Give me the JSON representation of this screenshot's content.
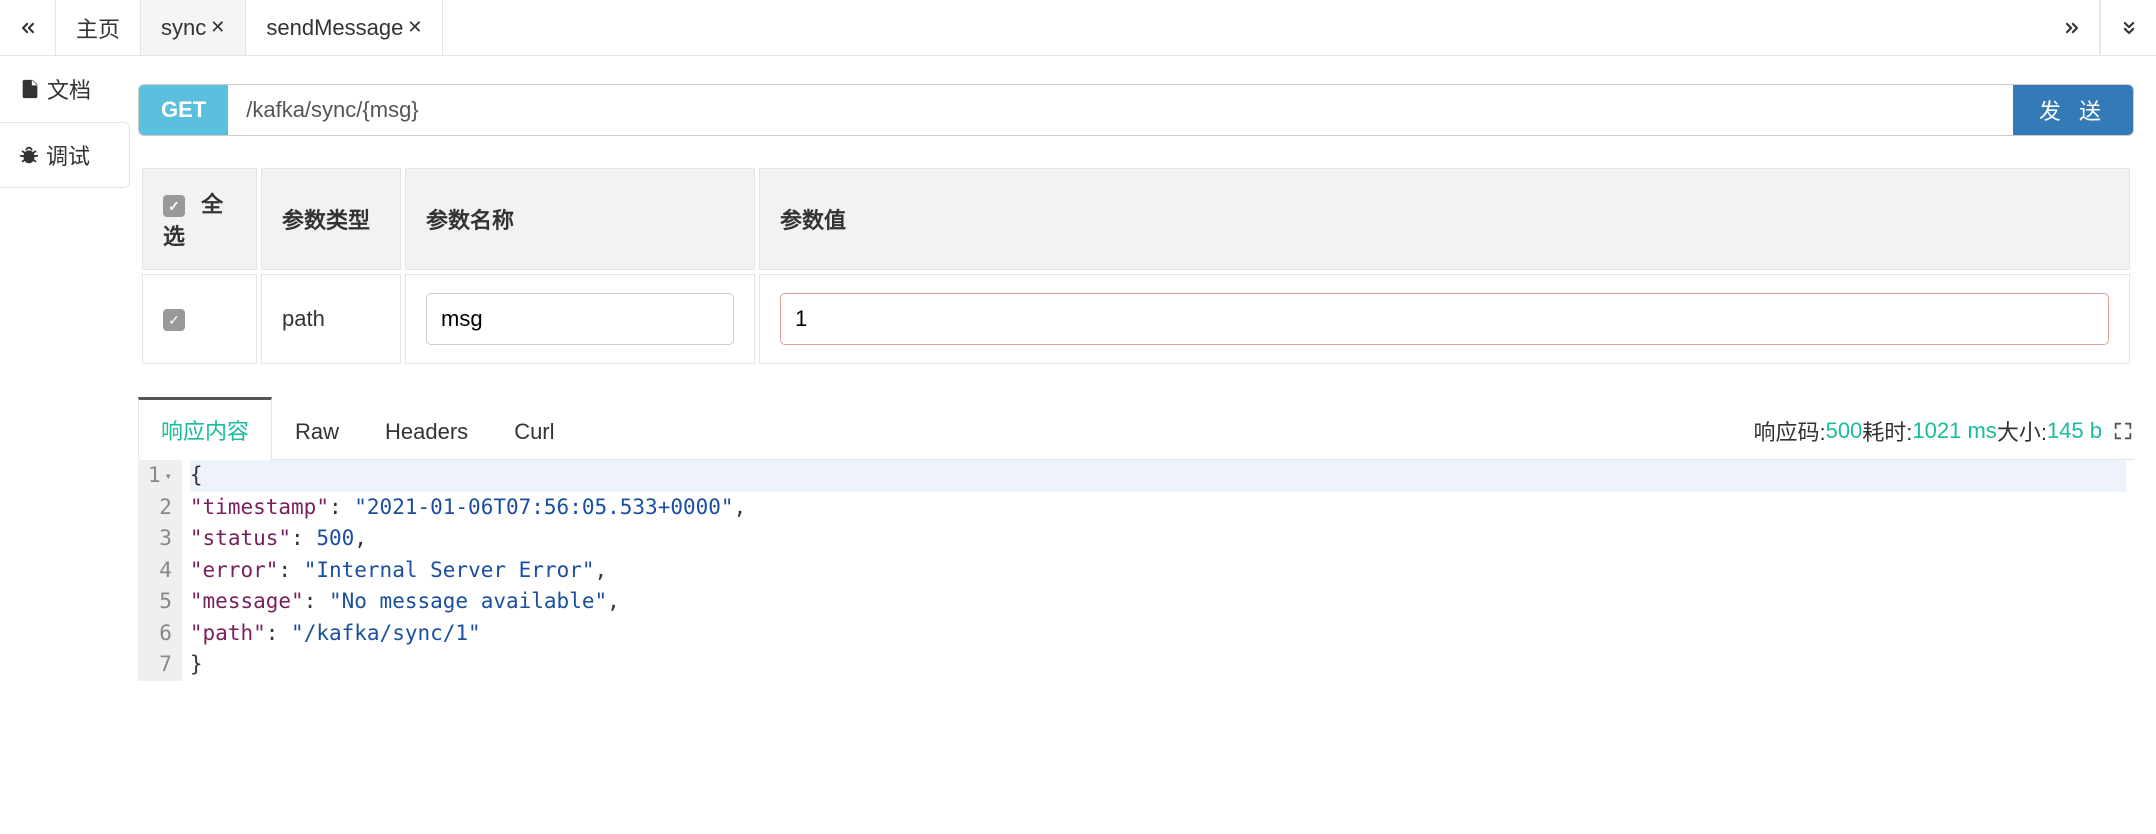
{
  "tabs": {
    "home": "主页",
    "items": [
      {
        "label": "sync",
        "active": true
      },
      {
        "label": "sendMessage",
        "active": false
      }
    ]
  },
  "sidebar": {
    "doc": "文档",
    "debug": "调试"
  },
  "request": {
    "method": "GET",
    "url": "/kafka/sync/{msg}",
    "send": "发 送"
  },
  "params": {
    "selectAll": "全选",
    "colType": "参数类型",
    "colName": "参数名称",
    "colValue": "参数值",
    "rows": [
      {
        "type": "path",
        "name": "msg",
        "value": "1"
      }
    ]
  },
  "response": {
    "tabs": {
      "content": "响应内容",
      "raw": "Raw",
      "headers": "Headers",
      "curl": "Curl"
    },
    "meta": {
      "codeLabel": "响应码:",
      "codeValue": "500",
      "timeLabel": "耗时:",
      "timeValue": "1021 ms",
      "sizeLabel": "大小:",
      "sizeValue": "145 b"
    },
    "body": {
      "timestamp": "2021-01-06T07:56:05.533+0000",
      "status": 500,
      "error": "Internal Server Error",
      "message": "No message available",
      "path": "/kafka/sync/1"
    }
  }
}
